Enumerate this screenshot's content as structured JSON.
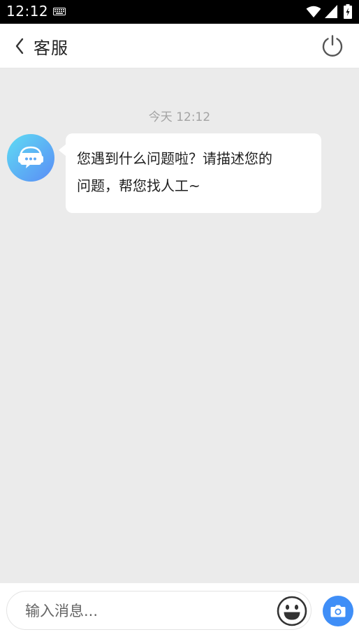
{
  "status_bar": {
    "time": "12:12",
    "icons": [
      "keyboard-icon",
      "wifi-icon",
      "signal-icon",
      "battery-icon"
    ]
  },
  "header": {
    "title": "客服",
    "back_icon": "chevron-left-icon",
    "action_icon": "power-icon"
  },
  "chat": {
    "timestamp": "今天 12:12",
    "messages": [
      {
        "sender": "bot",
        "avatar_icon": "chat-bot-icon",
        "line1": "您遇到什么问题啦？请描述您的",
        "line2": "问题，帮您找人工~"
      }
    ]
  },
  "input_bar": {
    "placeholder": "输入消息...",
    "value": "",
    "emoji_icon": "emoji-icon",
    "camera_icon": "camera-icon"
  },
  "colors": {
    "accent": "#3f8ef7",
    "chat_background": "#ebebeb",
    "bubble": "#ffffff"
  }
}
